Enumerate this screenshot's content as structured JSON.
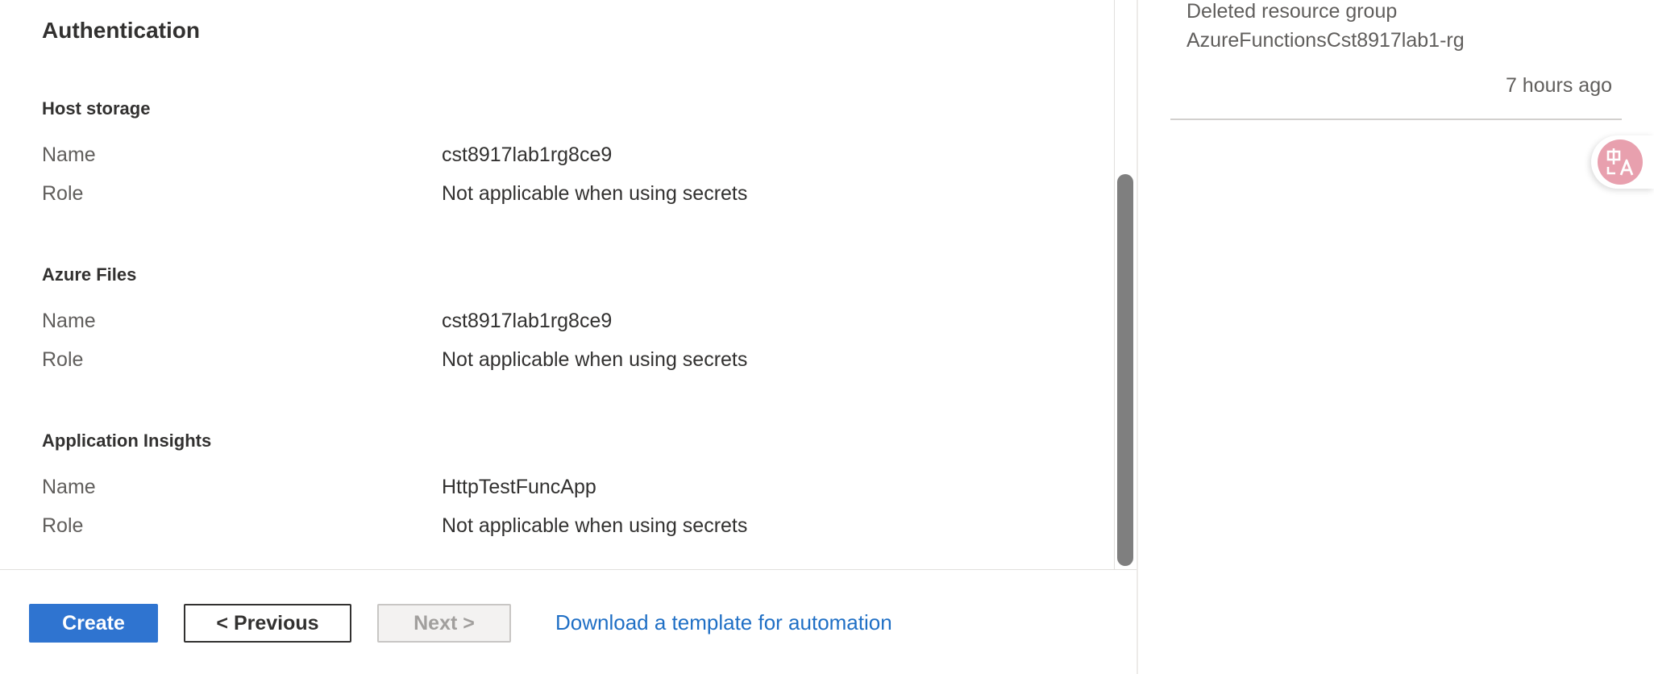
{
  "main": {
    "section_title": "Authentication",
    "groups": [
      {
        "title": "Host storage",
        "rows": [
          {
            "label": "Name",
            "value": "cst8917lab1rg8ce9"
          },
          {
            "label": "Role",
            "value": "Not applicable when using secrets"
          }
        ]
      },
      {
        "title": "Azure Files",
        "rows": [
          {
            "label": "Name",
            "value": "cst8917lab1rg8ce9"
          },
          {
            "label": "Role",
            "value": "Not applicable when using secrets"
          }
        ]
      },
      {
        "title": "Application Insights",
        "rows": [
          {
            "label": "Name",
            "value": "HttpTestFuncApp"
          },
          {
            "label": "Role",
            "value": "Not applicable when using secrets"
          }
        ]
      }
    ]
  },
  "footer": {
    "create_label": "Create",
    "previous_label": "< Previous",
    "next_label": "Next >",
    "template_link": "Download a template for automation"
  },
  "notifications": {
    "items": [
      {
        "line1": "Deleted resource group",
        "line2": "AzureFunctionsCst8917lab1-rg",
        "time": "7 hours ago"
      }
    ]
  },
  "widgets": {
    "translate_icon": "translate-icon",
    "accent_color": "#2f74d0",
    "link_color": "#1f6fc5"
  }
}
